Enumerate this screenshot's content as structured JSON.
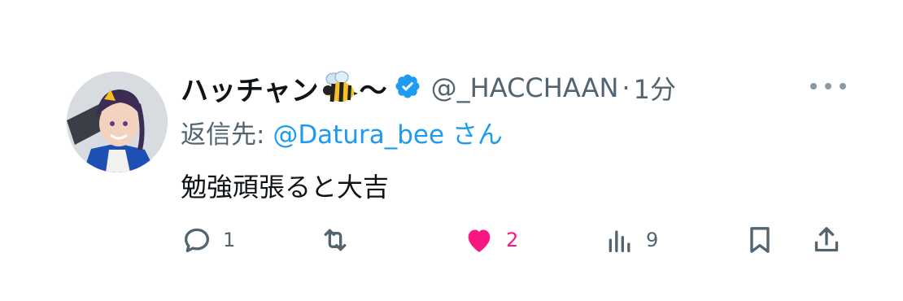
{
  "tweet": {
    "display_name": "ハッチャン",
    "emoji": "bee",
    "tilde": "〜",
    "handle": "@_HACCHAAN",
    "separator": "·",
    "time": "1分",
    "reply_prefix": "返信先: ",
    "reply_to": "@Datura_bee",
    "reply_suffix": " さん",
    "text": "勉強頑張ると大吉"
  },
  "actions": {
    "reply_count": "1",
    "retweet_count": "",
    "like_count": "2",
    "views_count": "9"
  },
  "icons": {
    "verified": "verified-badge-icon",
    "more": "more-icon",
    "reply": "reply-icon",
    "retweet": "retweet-icon",
    "like": "heart-icon",
    "views": "views-icon",
    "bookmark": "bookmark-icon",
    "share": "share-icon"
  },
  "colors": {
    "accent": "#1d9bf0",
    "like": "#f91880",
    "muted": "#536471",
    "text": "#0f1419"
  }
}
